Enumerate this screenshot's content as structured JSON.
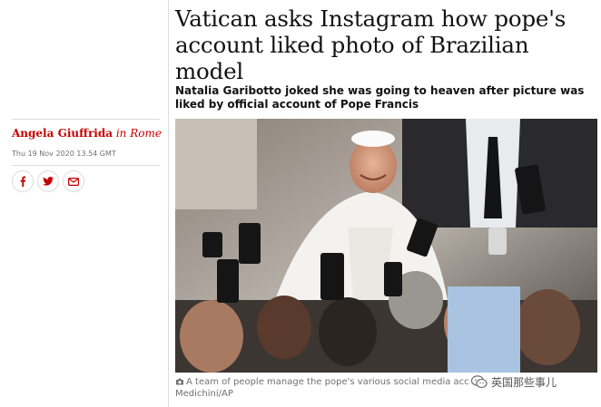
{
  "article": {
    "headline_line1": "Vatican asks Instagram how pope's",
    "headline_line2": "account liked photo of Brazilian model",
    "standfirst_line1": "Natalia Garibotto joked she was going to heaven after picture was",
    "standfirst_line2": "liked by official account of Pope Francis"
  },
  "byline": {
    "author": "Angela Giuffrida",
    "location": "in Rome",
    "date": "Thu 19 Nov 2020 13.54 GMT",
    "accent_color": "#c70000"
  },
  "share": {
    "icons": [
      "facebook-icon",
      "twitter-icon",
      "email-icon"
    ]
  },
  "photo": {
    "caption_line1": "A team of people manage the pope's various social media accounts.",
    "caption_fragment": "o",
    "caption_line2": "Medichini/AP"
  },
  "watermark": {
    "text": "英国那些事儿"
  }
}
